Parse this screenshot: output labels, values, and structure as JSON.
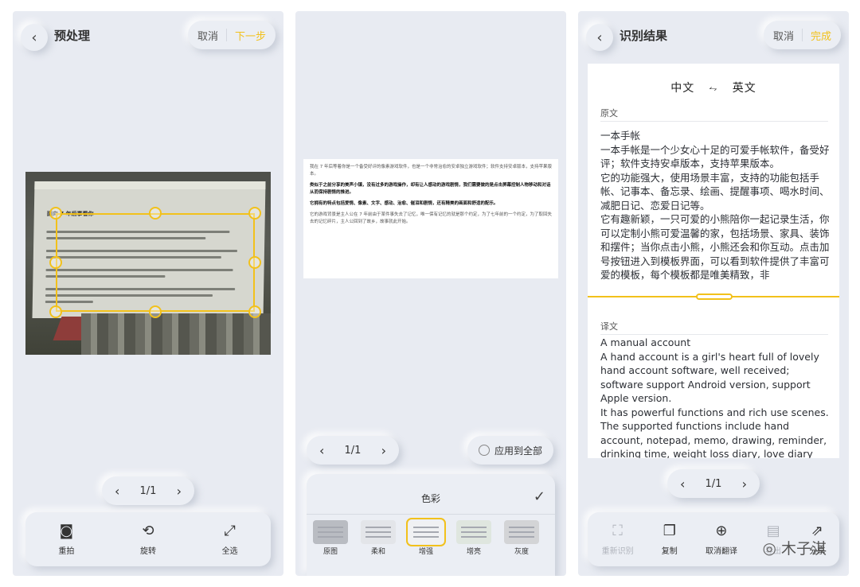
{
  "accent_color": "#f2c11b",
  "panel1": {
    "title": "预处理",
    "cancel": "取消",
    "next": "下一步",
    "photo_heading": "面向 7 年后事看你",
    "pager": "1/1",
    "tools": [
      {
        "icon": "camera-icon",
        "label": "重拍"
      },
      {
        "icon": "rotate-icon",
        "label": "旋转"
      },
      {
        "icon": "expand-icon",
        "label": "全选"
      }
    ]
  },
  "panel2": {
    "doc": {
      "p1": "我在 7 年后等着你是一个备受好评的像素游戏软件，也是一个非常治愈的安卓独立游戏软件；软件支持安卓版本，支持苹果版本。",
      "p2": "类似于之前分享的美声小镇，没有过多的游戏操作，却有让人感动的游戏剧情，我们需要做的是点击屏幕控制人物移动和对话从而保持剧情的推进。",
      "p3": "它拥有的特点包括爱情、像素、文字、感动、治愈、催泪和剧情，还有精美的画面和舒适的配乐。",
      "p4": "它的游戏背景是主人公在 7 年前由于某件事失去了记忆，唯一保有记忆的就是那个约定，为了七年前的一个约定，为了取回失去的记忆碎片，主人公回到了故乡，故事就此开始。"
    },
    "pager": "1/1",
    "apply_all": "应用到全部",
    "sheet_title": "色彩",
    "filters": [
      "原图",
      "柔和",
      "增强",
      "增亮",
      "灰度"
    ],
    "selected_filter": "增强"
  },
  "panel3": {
    "title": "识别结果",
    "cancel": "取消",
    "done": "完成",
    "source_lang": "中文",
    "target_lang": "英文",
    "swap_symbol": "⥊",
    "original_label": "原文",
    "original_text": "一本手帐\n一本手帐是一个少女心十足的可爱手帐软件，备受好评；软件支持安卓版本，支持苹果版本。\n它的功能强大，使用场景丰富，支持的功能包括手帐、记事本、备忘录、绘画、提醒事项、喝水时间、减肥日记、恋爱日记等。\n它有趣新颖，一只可爱的小熊陪你一起记录生活，你可以定制小熊可爱温馨的家，包括场景、家具、装饰和摆件；当你点击小熊，小熊还会和你互动。点击加号按钮进入到模板界面，可以看到软件提供了丰富可爱的模板，每个模板都是唯美精致，非",
    "translation_label": "译文",
    "translation_text": "A manual account\nA hand account is a girl's heart full of lovely hand account software, well received; software support Android version, support Apple version.\nIt has powerful functions and rich use scenes. The supported functions include hand account, notepad, memo, drawing, reminder, drinking time, weight loss diary, love diary",
    "pager": "1/1",
    "tools": [
      {
        "icon": "rescan-icon",
        "label": "重新识别",
        "disabled": true
      },
      {
        "icon": "copy-icon",
        "label": "复制",
        "disabled": false
      },
      {
        "icon": "globe-icon",
        "label": "取消翻译",
        "disabled": false
      },
      {
        "icon": "document-icon",
        "label": "导出",
        "disabled": true
      },
      {
        "icon": "share-icon",
        "label": "分享",
        "disabled": false
      }
    ],
    "watermark": "木子淇"
  }
}
